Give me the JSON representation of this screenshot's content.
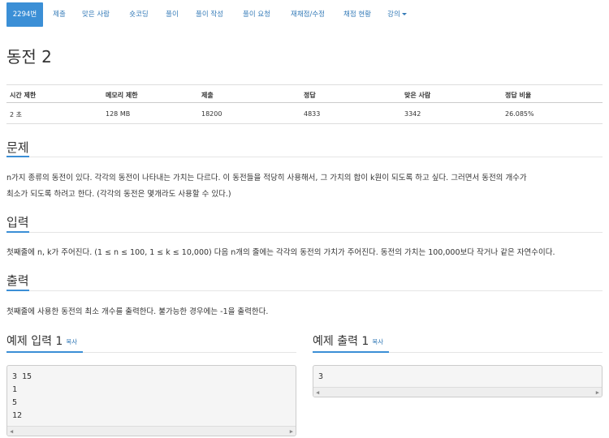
{
  "nav": {
    "tabs": [
      {
        "label": "2294번",
        "active": true
      },
      {
        "label": "제출"
      },
      {
        "label": "맞은 사람"
      },
      {
        "label": "숏코딩"
      },
      {
        "label": "풀이"
      },
      {
        "label": "풀이 작성"
      },
      {
        "label": "풀이 요청"
      },
      {
        "label": "재채점/수정"
      },
      {
        "label": "채점 현황"
      },
      {
        "label": "강의"
      }
    ]
  },
  "title": "동전 2",
  "stats": {
    "headers": [
      "시간 제한",
      "메모리 제한",
      "제출",
      "정답",
      "맞은 사람",
      "정답 비율"
    ],
    "values": [
      "2 초",
      "128 MB",
      "18200",
      "4833",
      "3342",
      "26.085%"
    ]
  },
  "problem": {
    "heading": "문제",
    "line1": "n가지 종류의 동전이 있다. 각각의 동전이 나타내는 가치는 다르다. 이 동전들을 적당히 사용해서, 그 가치의 합이 k원이 되도록 하고 싶다. 그러면서 동전의 개수가",
    "line2": "최소가 되도록 하려고 한다. (각각의 동전은 몇개라도 사용할 수 있다.)"
  },
  "input": {
    "heading": "입력",
    "text": "첫째줄에 n, k가 주어진다. (1 ≤ n ≤ 100, 1 ≤ k ≤ 10,000) 다음 n개의 줄에는 각각의 동전의 가치가 주어진다. 동전의 가치는 100,000보다 작거나 같은 자연수이다."
  },
  "output": {
    "heading": "출력",
    "text": "첫째줄에 사용한 동전의 최소 개수를 출력한다. 불가능한 경우에는 -1을 출력한다."
  },
  "sample_input": {
    "heading": "예제 입력 1",
    "copy": "복사",
    "lines": [
      "3 15",
      "1",
      "5",
      "12"
    ]
  },
  "sample_output": {
    "heading": "예제 출력 1",
    "copy": "복사",
    "lines": [
      "3"
    ]
  },
  "icons": {
    "caret": "chevron-down-icon",
    "scroll_left": "scroll-left-icon",
    "scroll_right": "scroll-right-icon"
  },
  "colors": {
    "accent": "#3b8fd6",
    "link": "#337ab7"
  }
}
